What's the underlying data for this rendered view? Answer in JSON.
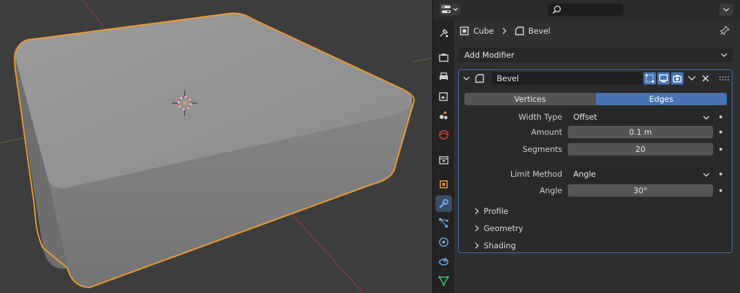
{
  "viewport": {
    "object_name": "Cube",
    "selection_color": "#f09a2a"
  },
  "topbar": {
    "editor_type_icon": "properties-editor-icon",
    "search_placeholder": "",
    "options_icon": "chevron-down-icon"
  },
  "tabs": [
    {
      "name": "tool",
      "icon": "tool-icon",
      "active": false
    },
    {
      "name": "render",
      "icon": "render-icon",
      "active": false
    },
    {
      "name": "output",
      "icon": "output-icon",
      "active": false
    },
    {
      "name": "view-layer",
      "icon": "view-layer-icon",
      "active": false
    },
    {
      "name": "scene",
      "icon": "scene-icon",
      "active": false
    },
    {
      "name": "world",
      "icon": "world-icon",
      "active": false
    },
    {
      "name": "collection",
      "icon": "collection-icon",
      "active": false
    },
    {
      "name": "object",
      "icon": "object-icon",
      "active": false
    },
    {
      "name": "modifiers",
      "icon": "wrench-icon",
      "active": true
    },
    {
      "name": "particles",
      "icon": "particles-icon",
      "active": false
    },
    {
      "name": "physics",
      "icon": "physics-icon",
      "active": false
    },
    {
      "name": "constraints",
      "icon": "constraints-icon",
      "active": false
    },
    {
      "name": "data",
      "icon": "mesh-data-icon",
      "active": false
    }
  ],
  "breadcrumb": {
    "object": "Cube",
    "modifier": "Bevel"
  },
  "add_modifier": "Add Modifier",
  "modifier": {
    "name": "Bevel",
    "affect_options": [
      "Vertices",
      "Edges"
    ],
    "affect_selected": "Edges",
    "width_type_label": "Width Type",
    "width_type_value": "Offset",
    "amount_label": "Amount",
    "amount_value": "0.1 m",
    "segments_label": "Segments",
    "segments_value": "20",
    "limit_method_label": "Limit Method",
    "limit_method_value": "Angle",
    "angle_label": "Angle",
    "angle_value": "30°",
    "subpanels": [
      "Profile",
      "Geometry",
      "Shading"
    ]
  },
  "colors": {
    "accent": "#4772b3",
    "selection": "#f09a2a",
    "background": "#303030"
  }
}
